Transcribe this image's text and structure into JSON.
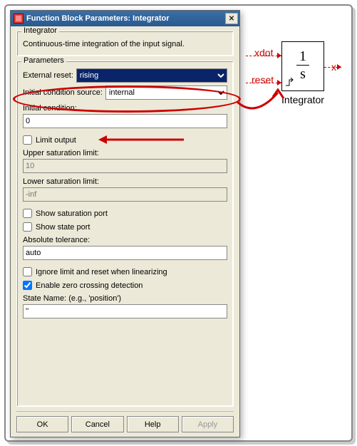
{
  "titlebar": {
    "title": "Function Block Parameters: Integrator"
  },
  "integrator_group": {
    "legend": "Integrator",
    "description": "Continuous-time integration of the input signal."
  },
  "parameters": {
    "legend": "Parameters",
    "external_reset_label": "External reset:",
    "external_reset_value": "rising",
    "initial_condition_source_label": "Initial condition source:",
    "initial_condition_source_value": "internal",
    "initial_condition_label": "Initial condition:",
    "initial_condition_value": "0",
    "limit_output_label": "Limit output",
    "limit_output_checked": false,
    "upper_saturation_label": "Upper saturation limit:",
    "upper_saturation_value": "10",
    "lower_saturation_label": "Lower saturation limit:",
    "lower_saturation_value": "-inf",
    "show_saturation_port_label": "Show saturation port",
    "show_saturation_port_checked": false,
    "show_state_port_label": "Show state port",
    "show_state_port_checked": false,
    "absolute_tolerance_label": "Absolute tolerance:",
    "absolute_tolerance_value": "auto",
    "ignore_linearizing_label": "Ignore limit and reset when linearizing",
    "ignore_linearizing_checked": false,
    "enable_zero_crossing_label": "Enable zero crossing detection",
    "enable_zero_crossing_checked": true,
    "state_name_label": "State Name: (e.g., 'position')",
    "state_name_value": "''"
  },
  "buttons": {
    "ok": "OK",
    "cancel": "Cancel",
    "help": "Help",
    "apply": "Apply"
  },
  "diagram": {
    "port_xdot": "xdot",
    "port_reset": "reset",
    "port_x": "x",
    "numerator": "1",
    "denominator": "s",
    "block_label": "Integrator"
  }
}
